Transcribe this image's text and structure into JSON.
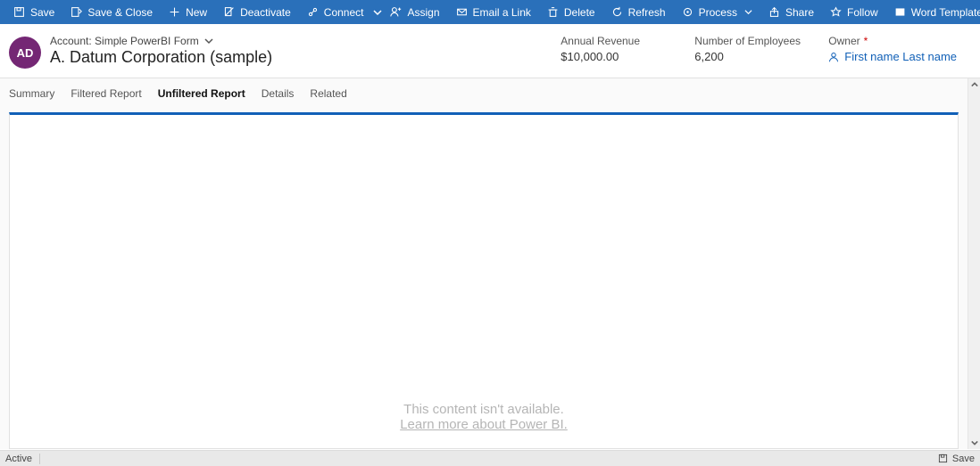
{
  "commandbar": {
    "save": "Save",
    "saveclose": "Save & Close",
    "new": "New",
    "deactivate": "Deactivate",
    "connect": "Connect",
    "assign": "Assign",
    "emaillink": "Email a Link",
    "delete": "Delete",
    "refresh": "Refresh",
    "process": "Process",
    "share": "Share",
    "follow": "Follow",
    "wordtemplates": "Word Templates"
  },
  "header": {
    "avatar_initials": "AD",
    "breadcrumb": "Account: Simple PowerBI Form",
    "title": "A. Datum Corporation (sample)",
    "fields": {
      "annual_revenue_label": "Annual Revenue",
      "annual_revenue_value": "$10,000.00",
      "employees_label": "Number of Employees",
      "employees_value": "6,200",
      "owner_label": "Owner",
      "owner_value": "First name Last name"
    }
  },
  "tabs": {
    "summary": "Summary",
    "filtered": "Filtered Report",
    "unfiltered": "Unfiltered Report",
    "details": "Details",
    "related": "Related"
  },
  "content": {
    "unavailable": "This content isn't available.",
    "learn_more": "Learn more about Power BI."
  },
  "statusbar": {
    "state": "Active",
    "save": "Save"
  }
}
